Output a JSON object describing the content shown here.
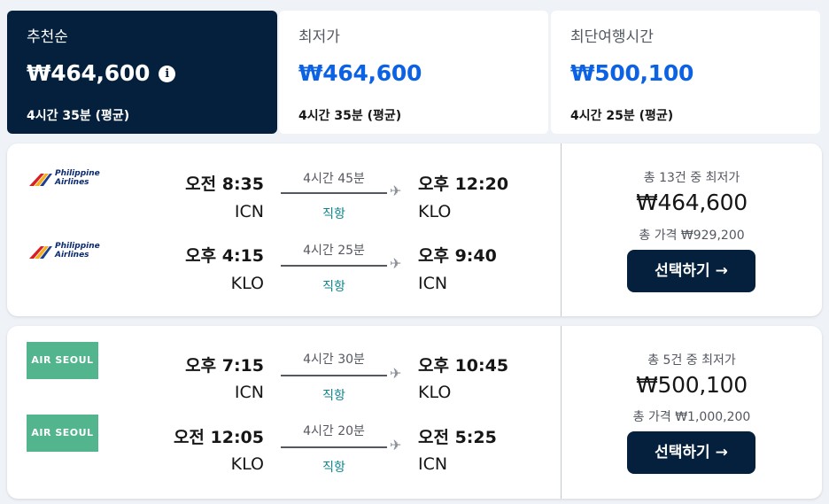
{
  "tabs": [
    {
      "label": "추천순",
      "price": "₩464,600",
      "duration": "4시간 35분 (평균)",
      "active": true
    },
    {
      "label": "최저가",
      "price": "₩464,600",
      "duration": "4시간 35분 (평균)",
      "active": false
    },
    {
      "label": "최단여행시간",
      "price": "₩500,100",
      "duration": "4시간 25분 (평균)",
      "active": false
    }
  ],
  "info_icon": "info-icon",
  "colors": {
    "brand_dark": "#05203c",
    "accent_blue": "#0b62e5",
    "direct_teal": "#0c838a",
    "airseoul_green": "#52b58e"
  },
  "results": [
    {
      "legs": [
        {
          "airline": "Philippine Airlines",
          "logo_lines": [
            "Philippine",
            "Airlines"
          ],
          "dep_time": "오전 8:35",
          "dep_code": "ICN",
          "duration": "4시간 45분",
          "stops": "직항",
          "arr_time": "오후 12:20",
          "arr_code": "KLO"
        },
        {
          "airline": "Philippine Airlines",
          "logo_lines": [
            "Philippine",
            "Airlines"
          ],
          "dep_time": "오후 4:15",
          "dep_code": "KLO",
          "duration": "4시간 25분",
          "stops": "직항",
          "arr_time": "오후 9:40",
          "arr_code": "ICN"
        }
      ],
      "deal_label": "총 13건 중 최저가",
      "price": "₩464,600",
      "total": "총 가격 ₩929,200",
      "select_label": "선택하기 →"
    },
    {
      "legs": [
        {
          "airline": "AIR SEOUL",
          "logo_lines": [
            "AIR SEOUL"
          ],
          "dep_time": "오후 7:15",
          "dep_code": "ICN",
          "duration": "4시간 30분",
          "stops": "직항",
          "arr_time": "오후 10:45",
          "arr_code": "KLO"
        },
        {
          "airline": "AIR SEOUL",
          "logo_lines": [
            "AIR SEOUL"
          ],
          "dep_time": "오전 12:05",
          "dep_code": "KLO",
          "duration": "4시간 20분",
          "stops": "직항",
          "arr_time": "오전 5:25",
          "arr_code": "ICN"
        }
      ],
      "deal_label": "총 5건 중 최저가",
      "price": "₩500,100",
      "total": "총 가격 ₩1,000,200",
      "select_label": "선택하기 →"
    }
  ]
}
